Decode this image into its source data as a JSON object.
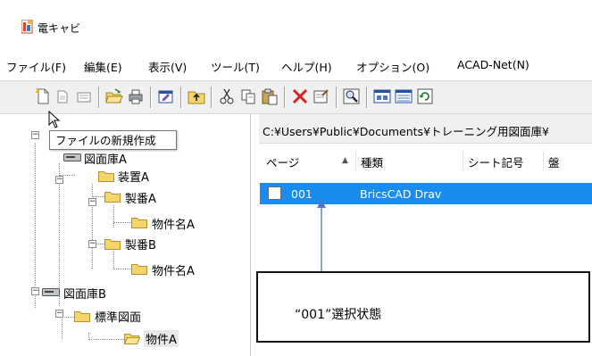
{
  "window": {
    "title": "電キャビ",
    "icon": "app-icon"
  },
  "menu": [
    "ファイル(F)",
    "編集(E)",
    "表示(V)",
    "ツール(T)",
    "ヘルプ(H)",
    "オプション(O)",
    "ACAD-Net(N)"
  ],
  "toolbar": {
    "icons": [
      "new-file-icon",
      "open-icon",
      "list-icon",
      "open-folder-icon",
      "print-icon",
      "edit-icon",
      "folder-up-icon",
      "cut-icon",
      "copy-icon",
      "paste-icon",
      "delete-icon",
      "properties-icon",
      "search-icon",
      "view-large-icon",
      "view-detail-icon",
      "refresh-icon"
    ]
  },
  "tooltip": "ファイルの新規作成",
  "tree": {
    "drawer_a": "図面庫A",
    "device_a": "装置A",
    "serial_a": "製番A",
    "property_a1": "物件名A",
    "serial_b": "製番B",
    "property_a2": "物件名A",
    "drawer_b": "図面庫B",
    "standard": "標準図面",
    "property_a": "物件A"
  },
  "path": "C:¥Users¥Public¥Documents¥トレーニング用図面庫¥",
  "list": {
    "columns": [
      "ページ",
      "種類",
      "シート記号",
      "盤"
    ],
    "sort_indicator": "▲",
    "rows": [
      {
        "page": "001",
        "kind": "BricsCAD Drav",
        "selected": true
      }
    ]
  },
  "annotation": "“001”選択状態",
  "colors": {
    "selection": "#1a8cf0",
    "folder": "#f3d56b",
    "annotation_line": "#4a78b8"
  }
}
